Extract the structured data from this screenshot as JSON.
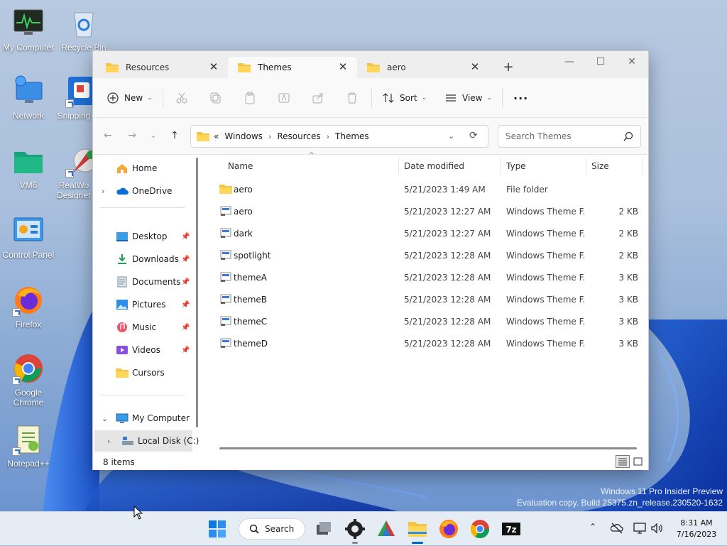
{
  "desktop": {
    "icons": [
      {
        "label": "My Computer",
        "icon": "monitor-pulse-icon"
      },
      {
        "label": "Recycle Bin",
        "icon": "recycle-bin-icon"
      },
      {
        "label": "Network",
        "icon": "network-icon"
      },
      {
        "label": "Snipping",
        "icon": "snipping-tool-icon"
      },
      {
        "label": "VM6",
        "icon": "folder-icon"
      },
      {
        "label": "RealWo",
        "label2": "Designer",
        "icon": "realworld-designer-icon"
      },
      {
        "label": "Control Panel",
        "icon": "control-panel-icon"
      },
      {
        "label": "Firefox",
        "icon": "firefox-icon"
      },
      {
        "label": "Google",
        "label2": "Chrome",
        "icon": "chrome-icon"
      },
      {
        "label": "Notepad++",
        "icon": "notepadpp-icon"
      }
    ],
    "watermark": {
      "line1": "Windows 11 Pro Insider Preview",
      "line2": "Evaluation copy. Build 25375.zn_release.230520-1632"
    }
  },
  "window": {
    "tabs": [
      {
        "label": "Resources",
        "active": false
      },
      {
        "label": "Themes",
        "active": true
      },
      {
        "label": "aero",
        "active": false
      }
    ],
    "toolbar": {
      "new_label": "New",
      "sort_label": "Sort",
      "view_label": "View",
      "more_label": "···"
    },
    "address": {
      "overflow": "«",
      "crumbs": [
        "Windows",
        "Resources",
        "Themes"
      ]
    },
    "search": {
      "placeholder": "Search Themes"
    },
    "sidebar": {
      "home": "Home",
      "onedrive": "OneDrive",
      "quick": [
        "Desktop",
        "Downloads",
        "Documents",
        "Pictures",
        "Music",
        "Videos",
        "Cursors"
      ],
      "my_computer": "My Computer",
      "local_disk": "Local Disk (C:)"
    },
    "columns": {
      "name": "Name",
      "date": "Date modified",
      "type": "Type",
      "size": "Size"
    },
    "files": [
      {
        "name": "aero",
        "date": "5/21/2023 1:49 AM",
        "type": "File folder",
        "size": "",
        "kind": "folder"
      },
      {
        "name": "aero",
        "date": "5/21/2023 12:27 AM",
        "type": "Windows Theme F...",
        "size": "2 KB",
        "kind": "theme"
      },
      {
        "name": "dark",
        "date": "5/21/2023 12:27 AM",
        "type": "Windows Theme F...",
        "size": "2 KB",
        "kind": "theme"
      },
      {
        "name": "spotlight",
        "date": "5/21/2023 12:28 AM",
        "type": "Windows Theme F...",
        "size": "2 KB",
        "kind": "theme"
      },
      {
        "name": "themeA",
        "date": "5/21/2023 12:28 AM",
        "type": "Windows Theme F...",
        "size": "3 KB",
        "kind": "theme"
      },
      {
        "name": "themeB",
        "date": "5/21/2023 12:28 AM",
        "type": "Windows Theme F...",
        "size": "3 KB",
        "kind": "theme"
      },
      {
        "name": "themeC",
        "date": "5/21/2023 12:28 AM",
        "type": "Windows Theme F...",
        "size": "3 KB",
        "kind": "theme"
      },
      {
        "name": "themeD",
        "date": "5/21/2023 12:28 AM",
        "type": "Windows Theme F...",
        "size": "3 KB",
        "kind": "theme"
      }
    ],
    "status": {
      "item_count": "8 items"
    }
  },
  "taskbar": {
    "search_label": "Search",
    "clock": {
      "time": "8:31 AM",
      "date": "7/16/2023"
    }
  },
  "colors": {
    "folder": "#f6c343",
    "accent": "#0067c0",
    "taskbar": "#e6ecf3"
  }
}
